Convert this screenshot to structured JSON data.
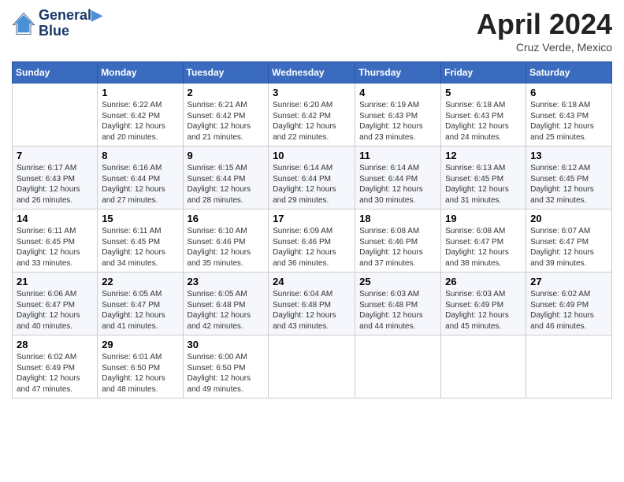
{
  "header": {
    "logo_line1": "General",
    "logo_line2": "Blue",
    "month": "April 2024",
    "location": "Cruz Verde, Mexico"
  },
  "days_of_week": [
    "Sunday",
    "Monday",
    "Tuesday",
    "Wednesday",
    "Thursday",
    "Friday",
    "Saturday"
  ],
  "weeks": [
    [
      {
        "num": "",
        "sunrise": "",
        "sunset": "",
        "daylight": ""
      },
      {
        "num": "1",
        "sunrise": "6:22 AM",
        "sunset": "6:42 PM",
        "daylight": "12 hours and 20 minutes."
      },
      {
        "num": "2",
        "sunrise": "6:21 AM",
        "sunset": "6:42 PM",
        "daylight": "12 hours and 21 minutes."
      },
      {
        "num": "3",
        "sunrise": "6:20 AM",
        "sunset": "6:42 PM",
        "daylight": "12 hours and 22 minutes."
      },
      {
        "num": "4",
        "sunrise": "6:19 AM",
        "sunset": "6:43 PM",
        "daylight": "12 hours and 23 minutes."
      },
      {
        "num": "5",
        "sunrise": "6:18 AM",
        "sunset": "6:43 PM",
        "daylight": "12 hours and 24 minutes."
      },
      {
        "num": "6",
        "sunrise": "6:18 AM",
        "sunset": "6:43 PM",
        "daylight": "12 hours and 25 minutes."
      }
    ],
    [
      {
        "num": "7",
        "sunrise": "6:17 AM",
        "sunset": "6:43 PM",
        "daylight": "12 hours and 26 minutes."
      },
      {
        "num": "8",
        "sunrise": "6:16 AM",
        "sunset": "6:44 PM",
        "daylight": "12 hours and 27 minutes."
      },
      {
        "num": "9",
        "sunrise": "6:15 AM",
        "sunset": "6:44 PM",
        "daylight": "12 hours and 28 minutes."
      },
      {
        "num": "10",
        "sunrise": "6:14 AM",
        "sunset": "6:44 PM",
        "daylight": "12 hours and 29 minutes."
      },
      {
        "num": "11",
        "sunrise": "6:14 AM",
        "sunset": "6:44 PM",
        "daylight": "12 hours and 30 minutes."
      },
      {
        "num": "12",
        "sunrise": "6:13 AM",
        "sunset": "6:45 PM",
        "daylight": "12 hours and 31 minutes."
      },
      {
        "num": "13",
        "sunrise": "6:12 AM",
        "sunset": "6:45 PM",
        "daylight": "12 hours and 32 minutes."
      }
    ],
    [
      {
        "num": "14",
        "sunrise": "6:11 AM",
        "sunset": "6:45 PM",
        "daylight": "12 hours and 33 minutes."
      },
      {
        "num": "15",
        "sunrise": "6:11 AM",
        "sunset": "6:45 PM",
        "daylight": "12 hours and 34 minutes."
      },
      {
        "num": "16",
        "sunrise": "6:10 AM",
        "sunset": "6:46 PM",
        "daylight": "12 hours and 35 minutes."
      },
      {
        "num": "17",
        "sunrise": "6:09 AM",
        "sunset": "6:46 PM",
        "daylight": "12 hours and 36 minutes."
      },
      {
        "num": "18",
        "sunrise": "6:08 AM",
        "sunset": "6:46 PM",
        "daylight": "12 hours and 37 minutes."
      },
      {
        "num": "19",
        "sunrise": "6:08 AM",
        "sunset": "6:47 PM",
        "daylight": "12 hours and 38 minutes."
      },
      {
        "num": "20",
        "sunrise": "6:07 AM",
        "sunset": "6:47 PM",
        "daylight": "12 hours and 39 minutes."
      }
    ],
    [
      {
        "num": "21",
        "sunrise": "6:06 AM",
        "sunset": "6:47 PM",
        "daylight": "12 hours and 40 minutes."
      },
      {
        "num": "22",
        "sunrise": "6:05 AM",
        "sunset": "6:47 PM",
        "daylight": "12 hours and 41 minutes."
      },
      {
        "num": "23",
        "sunrise": "6:05 AM",
        "sunset": "6:48 PM",
        "daylight": "12 hours and 42 minutes."
      },
      {
        "num": "24",
        "sunrise": "6:04 AM",
        "sunset": "6:48 PM",
        "daylight": "12 hours and 43 minutes."
      },
      {
        "num": "25",
        "sunrise": "6:03 AM",
        "sunset": "6:48 PM",
        "daylight": "12 hours and 44 minutes."
      },
      {
        "num": "26",
        "sunrise": "6:03 AM",
        "sunset": "6:49 PM",
        "daylight": "12 hours and 45 minutes."
      },
      {
        "num": "27",
        "sunrise": "6:02 AM",
        "sunset": "6:49 PM",
        "daylight": "12 hours and 46 minutes."
      }
    ],
    [
      {
        "num": "28",
        "sunrise": "6:02 AM",
        "sunset": "6:49 PM",
        "daylight": "12 hours and 47 minutes."
      },
      {
        "num": "29",
        "sunrise": "6:01 AM",
        "sunset": "6:50 PM",
        "daylight": "12 hours and 48 minutes."
      },
      {
        "num": "30",
        "sunrise": "6:00 AM",
        "sunset": "6:50 PM",
        "daylight": "12 hours and 49 minutes."
      },
      {
        "num": "",
        "sunrise": "",
        "sunset": "",
        "daylight": ""
      },
      {
        "num": "",
        "sunrise": "",
        "sunset": "",
        "daylight": ""
      },
      {
        "num": "",
        "sunrise": "",
        "sunset": "",
        "daylight": ""
      },
      {
        "num": "",
        "sunrise": "",
        "sunset": "",
        "daylight": ""
      }
    ]
  ]
}
